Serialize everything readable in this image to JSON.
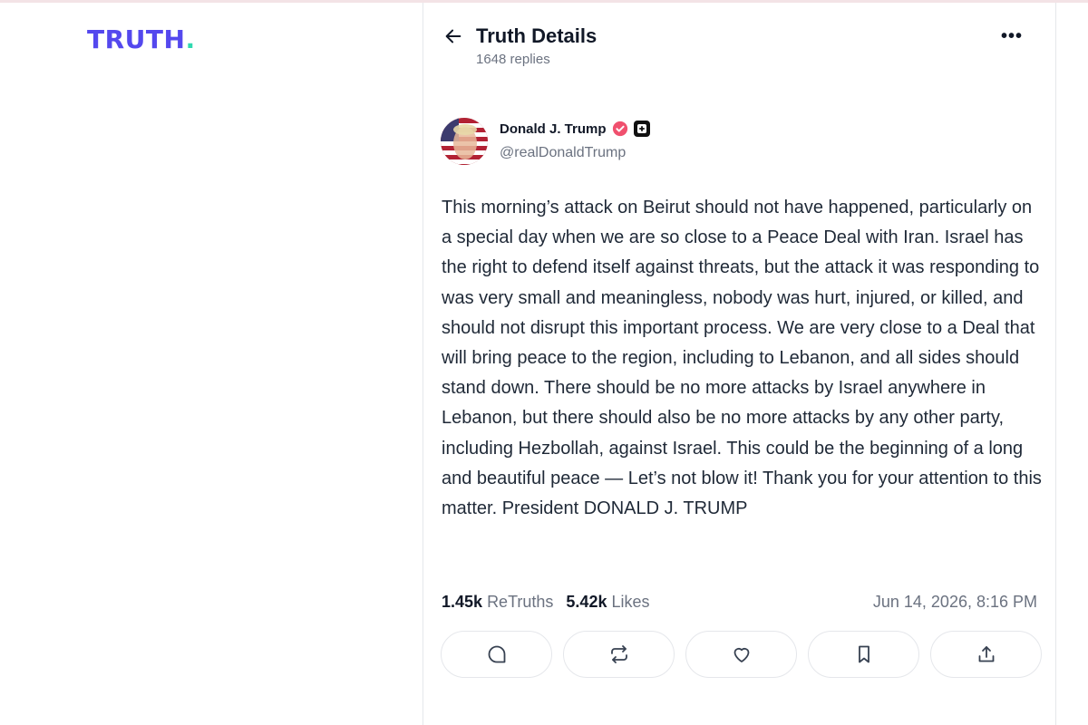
{
  "brand": {
    "logo_text": "TRUTH",
    "logo_dot": "."
  },
  "header": {
    "title": "Truth Details",
    "subtitle": "1648 replies",
    "back_icon": "arrow-left-icon",
    "more_label": "•••"
  },
  "post": {
    "author_name": "Donald J. Trump",
    "author_handle": "@realDonaldTrump",
    "body": "This morning’s attack on Beirut should not have happened, particularly on a special day when we are so close to a Peace Deal with Iran. Israel has the right to defend itself against threats, but the attack it was responding to was very small and meaningless, nobody was hurt, injured, or killed, and should not disrupt this important process. We are very close to a Deal that will bring peace to the region, including to Lebanon, and all sides should stand down. There should be no more attacks by Israel anywhere in Lebanon, but there should also be no more attacks by any other party, including Hezbollah, against Israel. This could be the beginning of a long and beautiful peace — Let’s not blow it! Thank you for your attention to this matter. President DONALD J. TRUMP",
    "retruths_count": "1.45k",
    "retruths_label": "ReTruths",
    "likes_count": "5.42k",
    "likes_label": "Likes",
    "timestamp": "Jun 14, 2026, 8:16 PM"
  },
  "actions": [
    {
      "icon": "reply-icon"
    },
    {
      "icon": "retruth-icon"
    },
    {
      "icon": "heart-icon"
    },
    {
      "icon": "bookmark-icon"
    },
    {
      "icon": "share-icon"
    }
  ],
  "colors": {
    "brand": "#5448ee",
    "brand_dot": "#2fd9b0",
    "verified": "#f0506e"
  }
}
